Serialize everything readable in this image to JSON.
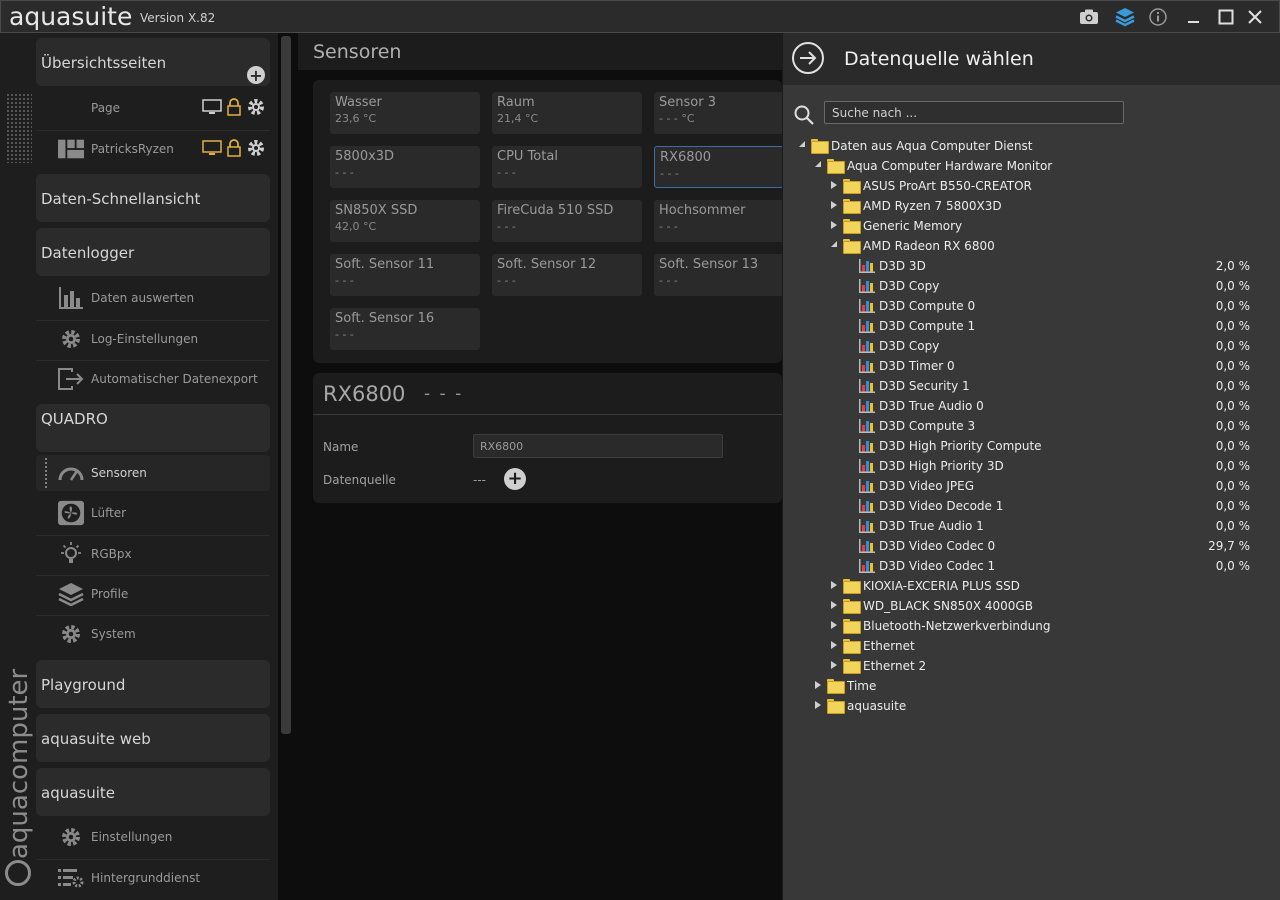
{
  "app": {
    "title": "aquasuite",
    "version": "Version X.82"
  },
  "brand": {
    "text": "aquacomputer"
  },
  "sidebar": {
    "sections": [
      {
        "label": "Übersichtsseiten"
      },
      {
        "label": "Daten-Schnellansicht"
      },
      {
        "label": "Datenlogger"
      },
      {
        "label": "QUADRO"
      },
      {
        "label": "Playground"
      },
      {
        "label": "aquasuite web"
      },
      {
        "label": "aquasuite"
      }
    ],
    "pages": [
      {
        "label": "Page"
      },
      {
        "label": "PatricksRyzen"
      }
    ],
    "logger_items": [
      {
        "label": "Daten auswerten"
      },
      {
        "label": "Log-Einstellungen"
      },
      {
        "label": "Automatischer Datenexport"
      }
    ],
    "quadro_items": [
      {
        "label": "Sensoren"
      },
      {
        "label": "Lüfter"
      },
      {
        "label": "RGBpx"
      },
      {
        "label": "Profile"
      },
      {
        "label": "System"
      }
    ],
    "aquasuite_items": [
      {
        "label": "Einstellungen"
      },
      {
        "label": "Hintergrunddienst"
      }
    ]
  },
  "main": {
    "title": "Sensoren",
    "tiles": [
      {
        "name": "Wasser",
        "value": "23,6 °C"
      },
      {
        "name": "Raum",
        "value": "21,4 °C"
      },
      {
        "name": "Sensor 3",
        "value": "- - - °C"
      },
      {
        "name": "5800x3D",
        "value": "- - -"
      },
      {
        "name": "CPU Total",
        "value": "- - -"
      },
      {
        "name": "RX6800",
        "value": "- - -"
      },
      {
        "name": "SN850X SSD",
        "value": "42,0 °C"
      },
      {
        "name": "FireCuda 510 SSD",
        "value": "- - -"
      },
      {
        "name": "Hochsommer",
        "value": "- - -"
      },
      {
        "name": "Soft. Sensor 11",
        "value": "- - -"
      },
      {
        "name": "Soft. Sensor 12",
        "value": "- - -"
      },
      {
        "name": "Soft. Sensor 13",
        "value": "- - -"
      },
      {
        "name": "Soft. Sensor 16",
        "value": "- - -"
      }
    ],
    "detail": {
      "title": "RX6800",
      "value": "- - -",
      "name_label": "Name",
      "name_value": "RX6800",
      "source_label": "Datenquelle",
      "source_value": "---"
    }
  },
  "datasource": {
    "title": "Datenquelle wählen",
    "search_placeholder": "Suche nach ...",
    "tree": [
      {
        "label": "Daten aus Aqua Computer Dienst",
        "type": "folder",
        "level": 0,
        "expanded": true
      },
      {
        "label": "Aqua Computer Hardware Monitor",
        "type": "folder",
        "level": 1,
        "expanded": true
      },
      {
        "label": "ASUS ProArt B550-CREATOR",
        "type": "folder",
        "level": 2,
        "expanded": false
      },
      {
        "label": "AMD Ryzen 7 5800X3D",
        "type": "folder",
        "level": 2,
        "expanded": false
      },
      {
        "label": "Generic Memory",
        "type": "folder",
        "level": 2,
        "expanded": false
      },
      {
        "label": "AMD Radeon RX 6800",
        "type": "folder",
        "level": 2,
        "expanded": true
      },
      {
        "label": "D3D 3D",
        "type": "sensor",
        "level": 3,
        "value": "2,0 %"
      },
      {
        "label": "D3D Copy",
        "type": "sensor",
        "level": 3,
        "value": "0,0 %"
      },
      {
        "label": "D3D Compute 0",
        "type": "sensor",
        "level": 3,
        "value": "0,0 %"
      },
      {
        "label": "D3D Compute 1",
        "type": "sensor",
        "level": 3,
        "value": "0,0 %"
      },
      {
        "label": "D3D Copy",
        "type": "sensor",
        "level": 3,
        "value": "0,0 %"
      },
      {
        "label": "D3D Timer 0",
        "type": "sensor",
        "level": 3,
        "value": "0,0 %"
      },
      {
        "label": "D3D Security 1",
        "type": "sensor",
        "level": 3,
        "value": "0,0 %"
      },
      {
        "label": "D3D True Audio 0",
        "type": "sensor",
        "level": 3,
        "value": "0,0 %"
      },
      {
        "label": "D3D Compute 3",
        "type": "sensor",
        "level": 3,
        "value": "0,0 %"
      },
      {
        "label": "D3D High Priority Compute",
        "type": "sensor",
        "level": 3,
        "value": "0,0 %"
      },
      {
        "label": "D3D High Priority 3D",
        "type": "sensor",
        "level": 3,
        "value": "0,0 %"
      },
      {
        "label": "D3D Video JPEG",
        "type": "sensor",
        "level": 3,
        "value": "0,0 %"
      },
      {
        "label": "D3D Video Decode 1",
        "type": "sensor",
        "level": 3,
        "value": "0,0 %"
      },
      {
        "label": "D3D True Audio 1",
        "type": "sensor",
        "level": 3,
        "value": "0,0 %"
      },
      {
        "label": "D3D Video Codec 0",
        "type": "sensor",
        "level": 3,
        "value": "29,7 %"
      },
      {
        "label": "D3D Video Codec 1",
        "type": "sensor",
        "level": 3,
        "value": "0,0 %"
      },
      {
        "label": "KIOXIA-EXCERIA PLUS SSD",
        "type": "folder",
        "level": 2,
        "expanded": false
      },
      {
        "label": "WD_BLACK SN850X 4000GB",
        "type": "folder",
        "level": 2,
        "expanded": false
      },
      {
        "label": "Bluetooth-Netzwerkverbindung",
        "type": "folder",
        "level": 2,
        "expanded": false
      },
      {
        "label": "Ethernet",
        "type": "folder",
        "level": 2,
        "expanded": false
      },
      {
        "label": "Ethernet 2",
        "type": "folder",
        "level": 2,
        "expanded": false
      },
      {
        "label": "Time",
        "type": "folder",
        "level": 1,
        "expanded": false
      },
      {
        "label": "aquasuite",
        "type": "folder",
        "level": 1,
        "expanded": false
      }
    ]
  },
  "colors": {
    "accent": "#3a9ad9",
    "folder": "#f3d45b",
    "selected_border": "#3a6ea8"
  }
}
